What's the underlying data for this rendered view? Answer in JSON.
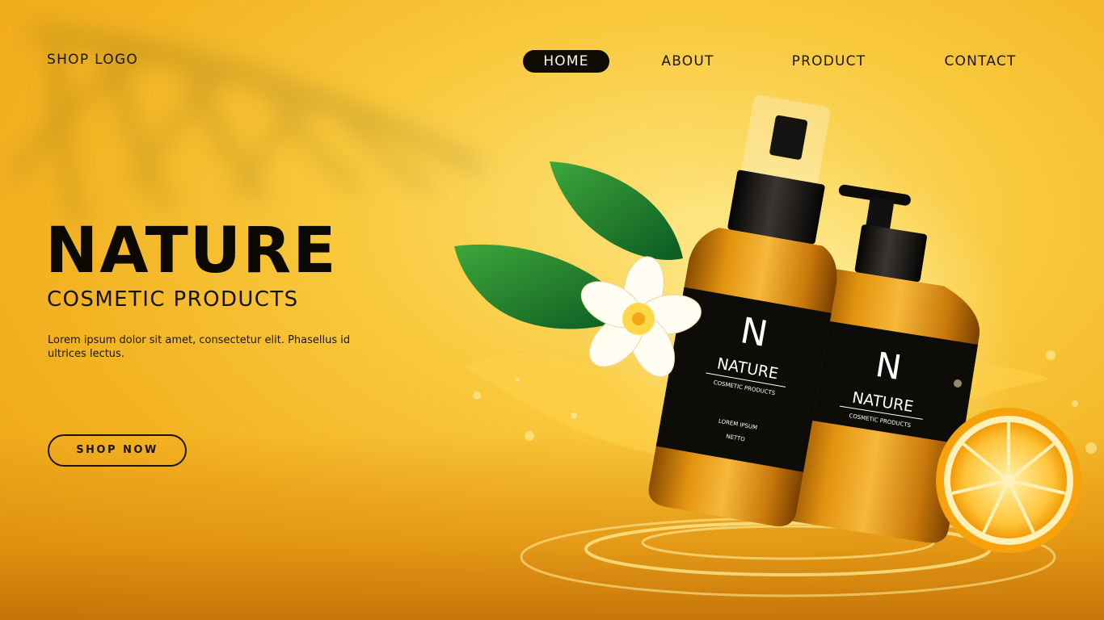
{
  "header": {
    "logo": "SHOP LOGO",
    "nav": [
      {
        "label": "HOME",
        "active": true
      },
      {
        "label": "ABOUT",
        "active": false
      },
      {
        "label": "PRODUCT",
        "active": false
      },
      {
        "label": "CONTACT",
        "active": false
      }
    ]
  },
  "hero": {
    "title": "NATURE",
    "subtitle": "COSMETIC PRODUCTS",
    "text": "Lorem ipsum dolor sit amet, consectetur elit. Phasellus id ultrices lectus.",
    "cta": "SHOP NOW"
  },
  "products": {
    "spray_bottle": {
      "letter": "N",
      "brand": "NATURE",
      "tagline": "COSMETIC PRODUCTS",
      "line1": "LOREM IPSUM",
      "line2": "NETTO"
    },
    "pump_bottle": {
      "letter": "N",
      "brand": "NATURE",
      "tagline": "COSMETIC PRODUCTS"
    }
  },
  "colors": {
    "background": "#f9c93d",
    "text": "#1a1505",
    "nav_active_bg": "#0f0c06",
    "bottle_amber": "#d9850a",
    "label_black": "#0e0c09"
  },
  "icons": [
    "palm-leaf-shadow-icon",
    "green-leaf-icon",
    "plumeria-flower-icon",
    "orange-slice-icon",
    "spray-bottle-icon",
    "pump-bottle-icon"
  ]
}
